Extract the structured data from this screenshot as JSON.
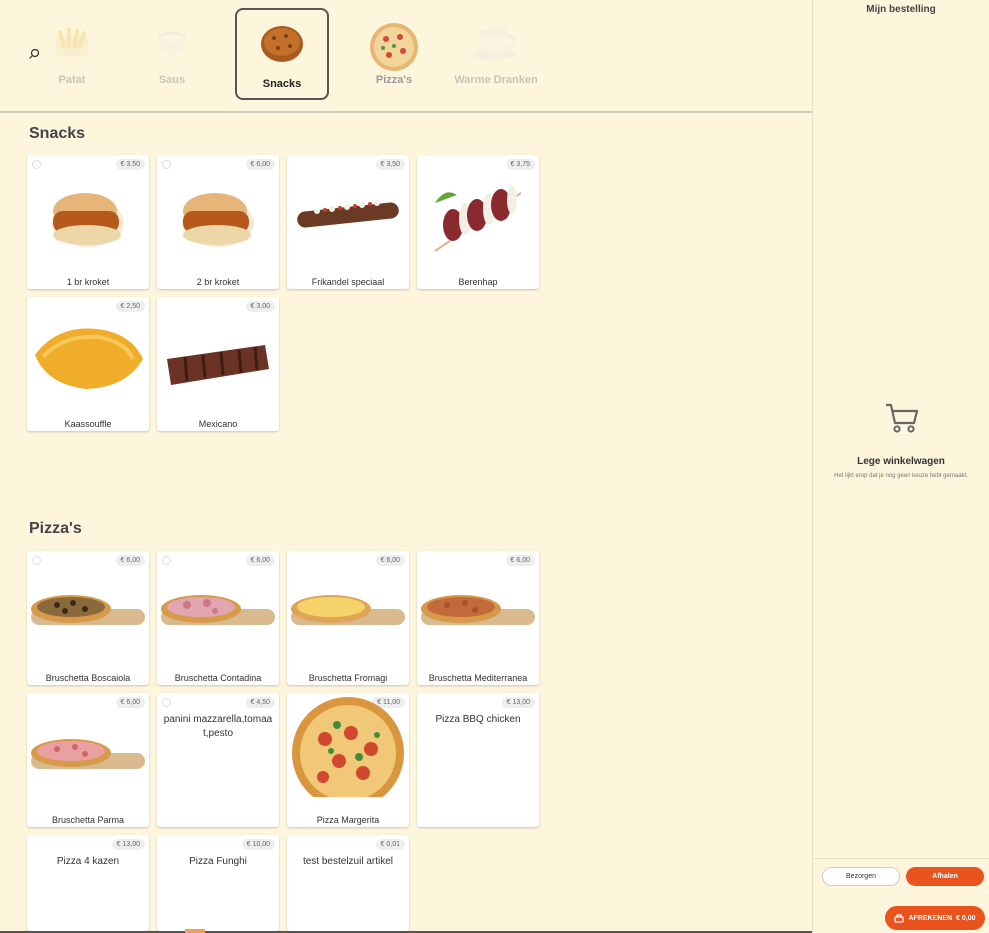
{
  "categories": [
    {
      "label": "Patat",
      "icon": "fries-icon"
    },
    {
      "label": "Saus",
      "icon": "sauce-cup-icon"
    },
    {
      "label": "Snacks",
      "icon": "snack-ball-icon",
      "active": true
    },
    {
      "label": "Pizza's",
      "icon": "pizza-icon"
    },
    {
      "label": "Warme Dranken",
      "icon": "coffee-cup-icon"
    }
  ],
  "sections": {
    "snacks": {
      "title": "Snacks",
      "items": [
        {
          "name": "1 br kroket",
          "price": "€ 3,50"
        },
        {
          "name": "2 br kroket",
          "price": "€ 6,00"
        },
        {
          "name": "Frikandel speciaal",
          "price": "€ 3,50"
        },
        {
          "name": "Berenhap",
          "price": "€ 3,75"
        },
        {
          "name": "Kaassouffle",
          "price": "€ 2,50"
        },
        {
          "name": "Mexicano",
          "price": "€ 3,00"
        }
      ]
    },
    "pizzas": {
      "title": "Pizza's",
      "items": [
        {
          "name": "Bruschetta Boscaiola",
          "price": "€ 6,00"
        },
        {
          "name": "Bruschetta Contadina",
          "price": "€ 6,00"
        },
        {
          "name": "Bruschetta Fromagi",
          "price": "€ 6,00"
        },
        {
          "name": "Bruschetta Mediterranea",
          "price": "€ 6,00"
        },
        {
          "name": "Bruschetta Parma",
          "price": "€ 6,00"
        },
        {
          "name": "panini mazzarella,tomaat,pesto",
          "price": "€ 4,50"
        },
        {
          "name": "Pizza Margerita",
          "price": "€ 11,00"
        },
        {
          "name": "Pizza BBQ chicken",
          "price": "€ 13,00"
        },
        {
          "name": "Pizza 4 kazen",
          "price": "€ 13,00"
        },
        {
          "name": "Pizza Funghi",
          "price": "€ 10,00"
        },
        {
          "name": "test bestelzuil artikel",
          "price": "€ 0,01"
        }
      ]
    }
  },
  "sidebar": {
    "title": "Mijn bestelling",
    "empty_title": "Lege winkelwagen",
    "empty_sub": "Het lijkt erop dat je nog geen keuze hebt gemaakt.",
    "btn_bezorgen": "Bezorgen",
    "btn_afhalen": "Afhalen",
    "btn_afrekenen": "AFREKENEN",
    "total": "€ 0,00"
  },
  "colors": {
    "accent": "#e8531e",
    "background": "#fdf5dc"
  }
}
